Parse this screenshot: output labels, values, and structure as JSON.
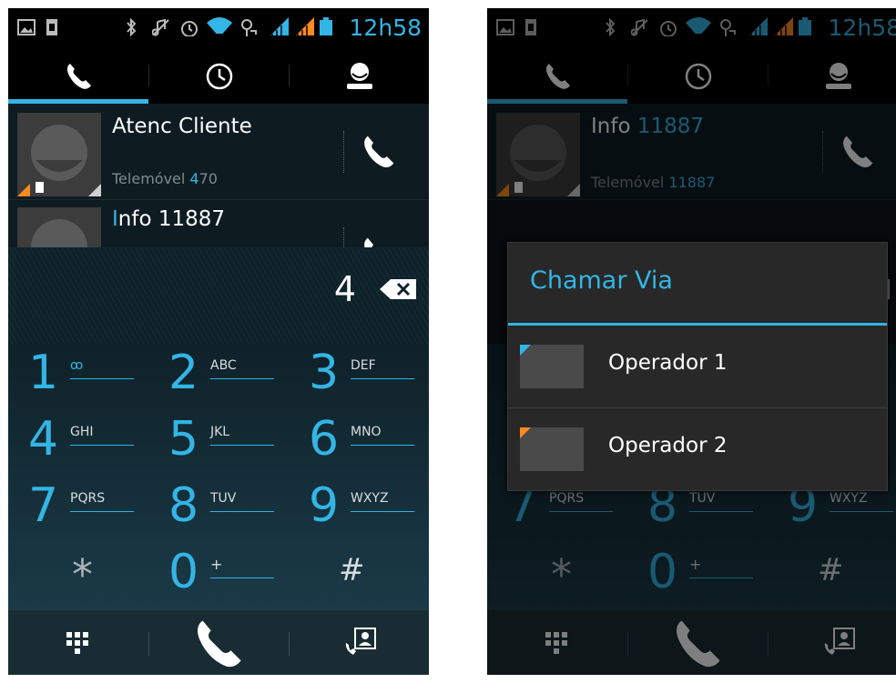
{
  "status_bar": {
    "time": "12h58",
    "icons": [
      "picture-icon",
      "sim-icon",
      "bluetooth-icon",
      "mute-icon",
      "alarm-icon",
      "wifi-icon",
      "usb-icon",
      "signal-1-icon",
      "signal-2-icon",
      "battery-icon"
    ]
  },
  "tabs": [
    {
      "name": "phone",
      "icon": "phone-icon",
      "selected": true
    },
    {
      "name": "recent",
      "icon": "clock-icon",
      "selected": false
    },
    {
      "name": "contacts",
      "icon": "person-icon",
      "selected": false
    }
  ],
  "left": {
    "contacts": [
      {
        "name": "Atenc Cliente",
        "sub_prefix": "Telemóvel ",
        "sub_highlight": "4",
        "sub_suffix": "70"
      },
      {
        "name_highlight": "I",
        "name_rest": "nfo 11887"
      }
    ],
    "typed_number": "4",
    "keys": [
      {
        "num": "1",
        "letters": "ꝏ"
      },
      {
        "num": "2",
        "letters": "ABC"
      },
      {
        "num": "3",
        "letters": "DEF"
      },
      {
        "num": "4",
        "letters": "GHI"
      },
      {
        "num": "5",
        "letters": "JKL"
      },
      {
        "num": "6",
        "letters": "MNO"
      },
      {
        "num": "7",
        "letters": "PQRS"
      },
      {
        "num": "8",
        "letters": "TUV"
      },
      {
        "num": "9",
        "letters": "WXYZ"
      },
      {
        "num": "*",
        "letters": ""
      },
      {
        "num": "0",
        "letters": "+"
      },
      {
        "num": "#",
        "letters": ""
      }
    ]
  },
  "right": {
    "contact": {
      "name_prefix": "Info ",
      "name_highlight": "11887",
      "sub_prefix": "Telemóvel ",
      "sub_highlight": "11887"
    },
    "keys_visible": [
      {
        "num": "7",
        "letters": "PQRS"
      },
      {
        "num": "8",
        "letters": "TUV"
      },
      {
        "num": "9",
        "letters": "WXYZ"
      },
      {
        "num": "*",
        "letters": ""
      },
      {
        "num": "0",
        "letters": "+"
      },
      {
        "num": "#",
        "letters": ""
      }
    ],
    "dialog": {
      "title": "Chamar Via",
      "options": [
        {
          "label": "Operador 1",
          "corner_color": "#33b5e5"
        },
        {
          "label": "Operador 2",
          "corner_color": "#ff8a1f"
        }
      ]
    }
  },
  "colors": {
    "accent": "#33b5e5",
    "sim1": "#33b5e5",
    "sim2": "#ff8a1f"
  }
}
